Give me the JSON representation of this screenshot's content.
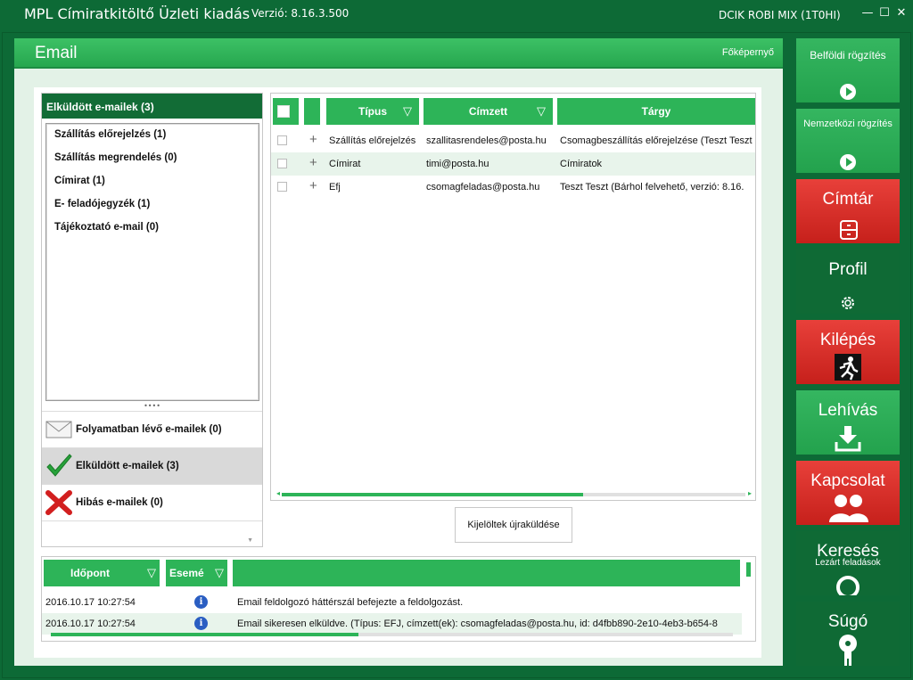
{
  "app": {
    "title": "MPL Címiratkitöltő Üzleti kiadás",
    "version": "Verzió: 8.16.3.500",
    "user": "DCIK ROBI MIX  (1T0HI)"
  },
  "window": {
    "minimize": "—",
    "maximize": "☐",
    "close": "✕"
  },
  "page": {
    "title": "Email",
    "home_link": "Főképernyő"
  },
  "left_panel": {
    "header": "Elküldött e-mailek (3)",
    "categories": [
      "Szállítás előrejelzés (1)",
      "Szállítás megrendelés (0)",
      "Címirat (1)",
      "E- feladójegyzék (1)",
      "Tájékoztató e-mail (0)"
    ],
    "splitter": "••••",
    "buttons": {
      "in_progress": "Folyamatban lévő e-mailek (0)",
      "sent": "Elküldött e-mailek (3)",
      "failed": "Hibás e-mailek (0)"
    }
  },
  "grid": {
    "columns": {
      "type": "Típus",
      "recipient": "Címzett",
      "subject": "Tárgy"
    },
    "rows": [
      {
        "type": "Szállítás előrejelzés",
        "recipient": "szallitasrendeles@posta.hu",
        "subject": "Csomagbeszállítás előrejelzése (Teszt Teszt"
      },
      {
        "type": "Címirat",
        "recipient": "timi@posta.hu",
        "subject": "Címiratok"
      },
      {
        "type": "Efj",
        "recipient": "csomagfeladas@posta.hu",
        "subject": "Teszt Teszt (Bárhol felvehető, verzió: 8.16."
      }
    ],
    "hscroll_fraction": 0.65
  },
  "resend_button": "Kijelöltek újraküldése",
  "log": {
    "columns": {
      "time": "Időpont",
      "event": "Esemé"
    },
    "rows": [
      {
        "time": "2016.10.17 10:27:54",
        "message": "Email feldolgozó háttérszál befejezte a feldolgozást."
      },
      {
        "time": "2016.10.17 10:27:54",
        "message": "Email sikeresen elküldve. (Típus: EFJ, címzett(ek): csomagfeladas@posta.hu, id: d4fbb890-2e10-4eb3-b654-8"
      }
    ]
  },
  "sidebar": {
    "domestic": "Belföldi rögzítés",
    "international": "Nemzetközi rögzítés",
    "address_book": "Címtár",
    "profile": "Profil",
    "exit": "Kilépés",
    "download": "Lehívás",
    "contact": "Kapcsolat",
    "search": "Keresés",
    "search_sub": "Lezárt feladások",
    "help": "Súgó"
  },
  "colors": {
    "frame": "#0d6a36",
    "accent_green": "#2db458",
    "tile_red": "#d72c26",
    "tile_dark": "#0f6a35",
    "panel_bg": "#e3f2e7"
  }
}
